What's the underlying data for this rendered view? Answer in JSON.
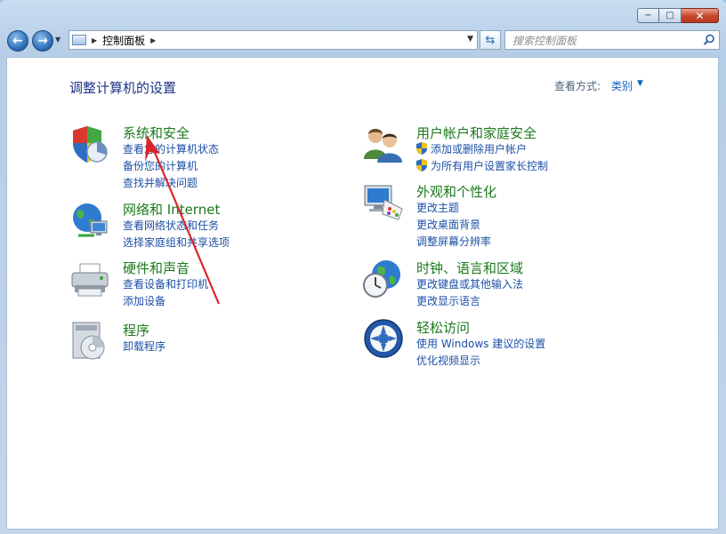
{
  "window": {
    "caption_buttons": {
      "minimize": "−",
      "maximize": "□",
      "close": "✕"
    }
  },
  "navbar": {
    "back_icon": "back-arrow-icon",
    "forward_icon": "forward-arrow-icon",
    "breadcrumb": "控制面板",
    "search_placeholder": "搜索控制面板"
  },
  "page": {
    "title": "调整计算机的设置",
    "view_by_label": "查看方式:",
    "view_by_value": "类别"
  },
  "categories_left": [
    {
      "title": "系统和安全",
      "links": [
        "查看您的计算机状态",
        "备份您的计算机",
        "查找并解决问题"
      ],
      "icon": "shield-flag-icon"
    },
    {
      "title": "网络和 Internet",
      "links": [
        "查看网络状态和任务",
        "选择家庭组和共享选项"
      ],
      "icon": "network-globe-icon"
    },
    {
      "title": "硬件和声音",
      "links": [
        "查看设备和打印机",
        "添加设备"
      ],
      "icon": "printer-icon"
    },
    {
      "title": "程序",
      "links": [
        "卸载程序"
      ],
      "icon": "programs-disc-icon"
    }
  ],
  "categories_right": [
    {
      "title": "用户帐户和家庭安全",
      "links": [
        "添加或删除用户帐户",
        "为所有用户设置家长控制"
      ],
      "icon": "users-icon"
    },
    {
      "title": "外观和个性化",
      "links": [
        "更改主题",
        "更改桌面背景",
        "调整屏幕分辨率"
      ],
      "icon": "monitor-palette-icon"
    },
    {
      "title": "时钟、语言和区域",
      "links": [
        "更改键盘或其他输入法",
        "更改显示语言"
      ],
      "icon": "clock-globe-icon"
    },
    {
      "title": "轻松访问",
      "links": [
        "使用 Windows 建议的设置",
        "优化视频显示"
      ],
      "icon": "ease-of-access-icon"
    }
  ],
  "colors": {
    "category_title": "#1c7a1c",
    "link": "#1d4fa6",
    "page_title": "#1e3287",
    "annotation_arrow": "#d8262a"
  }
}
